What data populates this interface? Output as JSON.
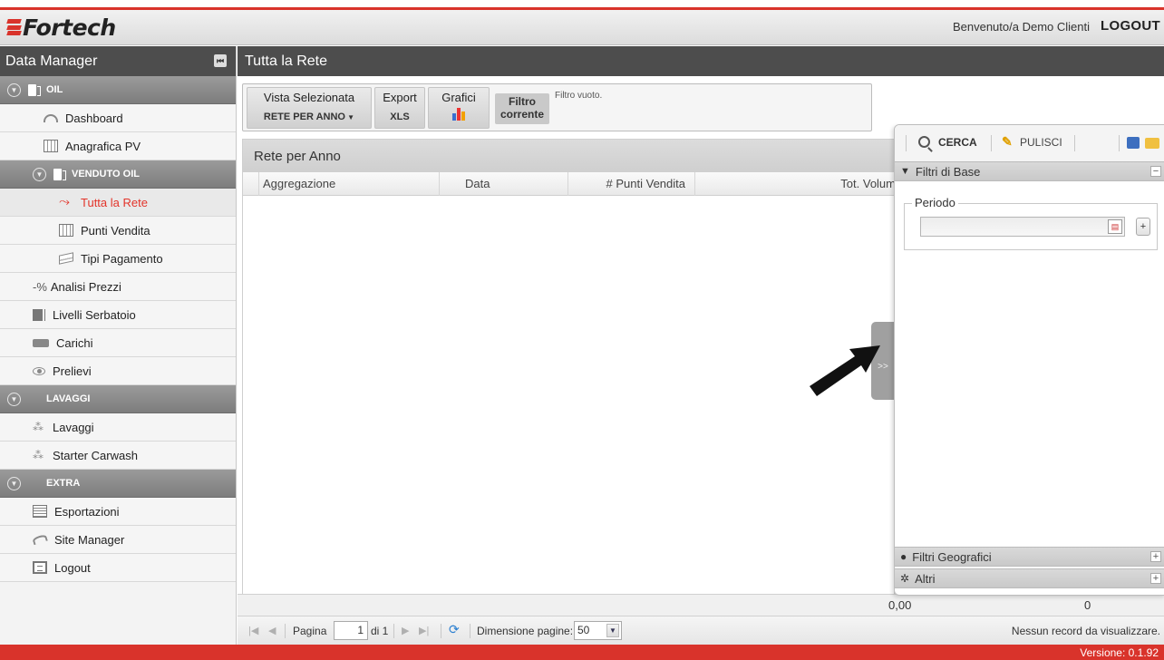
{
  "header": {
    "brand": "Fortech",
    "welcome": "Benvenuto/a Demo Clienti",
    "logout": "LOGOUT"
  },
  "sidebar": {
    "title": "Data Manager",
    "groups": {
      "oil": "OIL",
      "venduto_oil": "VENDUTO OIL",
      "lavaggi": "LAVAGGI",
      "extra": "EXTRA"
    },
    "items": {
      "dashboard": "Dashboard",
      "anagrafica": "Anagrafica PV",
      "tutta_rete": "Tutta la Rete",
      "punti_vendita": "Punti Vendita",
      "tipi_pagamento": "Tipi Pagamento",
      "analisi_prezzi": "Analisi Prezzi",
      "livelli_serbatoio": "Livelli Serbatoio",
      "carichi": "Carichi",
      "prelievi": "Prelievi",
      "lavaggi": "Lavaggi",
      "starter_carwash": "Starter Carwash",
      "esportazioni": "Esportazioni",
      "site_manager": "Site Manager",
      "logout": "Logout"
    },
    "icons": {
      "pct": "-%"
    }
  },
  "main": {
    "title": "Tutta la Rete",
    "toolbar": {
      "vista_label": "Vista Selezionata",
      "vista_value": "RETE PER ANNO",
      "export_label": "Export",
      "export_value": "XLS",
      "grafici_label": "Grafici",
      "filtro_label": "Filtro corrente",
      "filtro_value": "Filtro vuoto."
    },
    "grid": {
      "title": "Rete per Anno",
      "columns": [
        "Aggregazione",
        "Data",
        "# Punti Vendita",
        "Tot. Volum"
      ],
      "summary": {
        "total_value": "0,00",
        "total_count": "0"
      }
    },
    "pager": {
      "page_label": "Pagina",
      "page_value": "1",
      "of_label": "di 1",
      "page_size_label": "Dimensione pagine:",
      "page_size_value": "50",
      "empty_text": "Nessun record da visualizzare."
    }
  },
  "filter_panel": {
    "search": "CERCA",
    "clear": "PULISCI",
    "base_section": "Filtri di Base",
    "period_label": "Periodo",
    "period_value": "",
    "geo_section": "Filtri Geografici",
    "other_section": "Altri",
    "tab_glyph": ">>"
  },
  "footer": {
    "version": "Versione: 0.1.92"
  },
  "colors": {
    "accent_red": "#d9332b",
    "dark_bar": "#4d4d4d",
    "active_text": "#e3342a"
  }
}
